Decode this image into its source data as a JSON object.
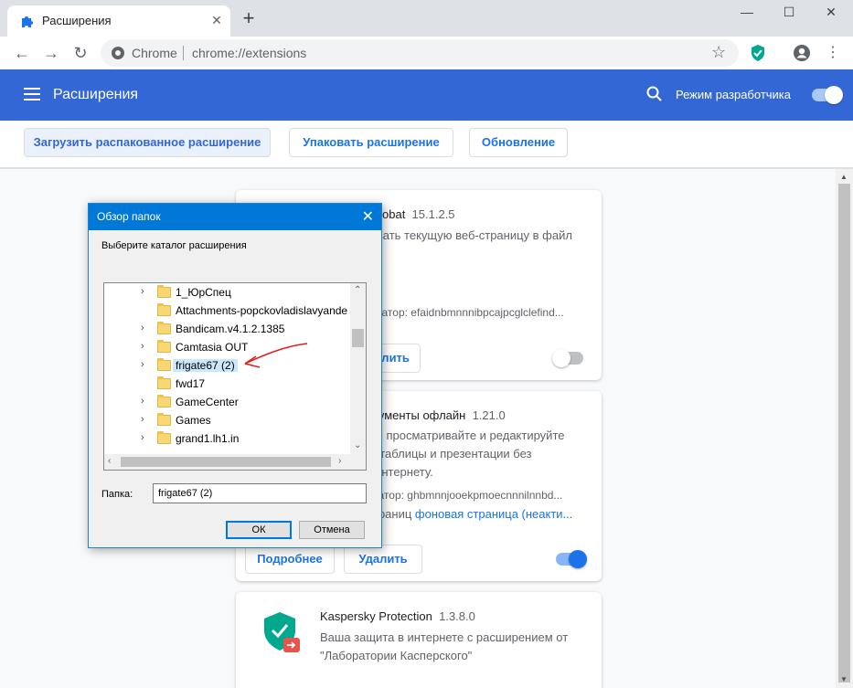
{
  "browser": {
    "tab_title": "Расширения",
    "tab_close": "✕",
    "new_tab": "+",
    "scheme": "Chrome",
    "url": "chrome://extensions",
    "win_minimize": "—",
    "win_maximize": "☐",
    "win_close": "✕"
  },
  "header": {
    "title": "Расширения",
    "dev_mode_label": "Режим разработчика",
    "dev_mode_on": true,
    "accent": "#3367d6"
  },
  "actions": {
    "load": "Загрузить распакованное расширение",
    "pack": "Упаковать расширение",
    "update": "Обновление"
  },
  "cards": [
    {
      "name_visible": "obat",
      "version": "15.1.2.5",
      "desc_visible": "вать текущую веб-страницу в файл",
      "id_visible": "катор: efaidnbmnnnibpcajpcglclefind...",
      "remove_visible": "алить",
      "enabled": false
    },
    {
      "name_visible": "кументы офлайн",
      "version": "1.21.0",
      "desc_line1": "е, просматривайте и редактируйте",
      "desc_line2": ", таблицы и презентации без",
      "desc_line3": "Интернету.",
      "id_visible": "катор: ghbmnnjooekpmoecnnnilnnbd...",
      "bg_prefix": "траниц ",
      "bg_link": "фоновая страница (неакти...",
      "details": "Подробнее",
      "remove": "Удалить",
      "enabled": true
    },
    {
      "name": "Kaspersky Protection",
      "version": "1.3.8.0",
      "desc_line1": "Ваша защита в интернете с расширением от",
      "desc_line2": "\"Лаборатории Касперского\""
    }
  ],
  "dialog": {
    "title": "Обзор папок",
    "close": "✕",
    "prompt": "Выберите каталог расширения",
    "tree": [
      {
        "label": "1_ЮрСпец",
        "expandable": true
      },
      {
        "label": "Attachments-popckovladislavyande",
        "expandable": false
      },
      {
        "label": "Bandicam.v4.1.2.1385",
        "expandable": true
      },
      {
        "label": "Camtasia OUT",
        "expandable": true
      },
      {
        "label": "frigate67 (2)",
        "expandable": true,
        "selected": true
      },
      {
        "label": "fwd17",
        "expandable": false
      },
      {
        "label": "GameCenter",
        "expandable": true
      },
      {
        "label": "Games",
        "expandable": true
      },
      {
        "label": "grand1.lh1.in",
        "expandable": true
      }
    ],
    "folder_label": "Папка:",
    "folder_value": "frigate67 (2)",
    "ok": "ОК",
    "cancel": "Отмена"
  }
}
